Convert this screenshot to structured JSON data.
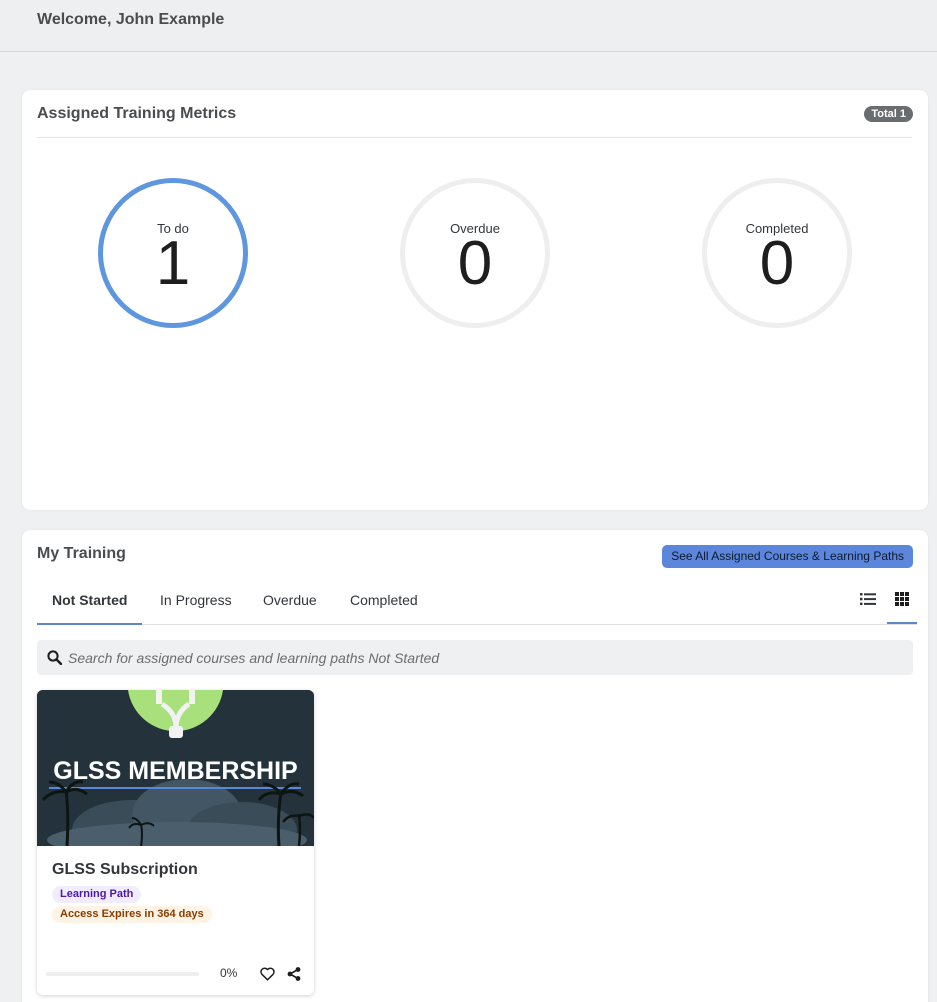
{
  "header": {
    "welcome": "Welcome, John Example"
  },
  "metrics": {
    "title": "Assigned Training Metrics",
    "total_badge": "Total 1",
    "items": [
      {
        "label": "To do",
        "value": "1",
        "ring_color": "#5f96e0"
      },
      {
        "label": "Overdue",
        "value": "0",
        "ring_color": "#eeeeee"
      },
      {
        "label": "Completed",
        "value": "0",
        "ring_color": "#eeeeee"
      }
    ]
  },
  "training": {
    "title": "My Training",
    "see_all_label": "See All Assigned Courses & Learning Paths",
    "tabs": [
      {
        "label": "Not Started",
        "selected": true
      },
      {
        "label": "In Progress",
        "selected": false
      },
      {
        "label": "Overdue",
        "selected": false
      },
      {
        "label": "Completed",
        "selected": false
      }
    ],
    "view_modes": [
      {
        "icon": "list-view-icon",
        "selected": false
      },
      {
        "icon": "grid-view-icon",
        "selected": true
      }
    ],
    "search": {
      "placeholder": "Search for assigned courses and learning paths Not Started",
      "value": ""
    },
    "courses": [
      {
        "image_text": "GLSS MEMBERSHIP",
        "name": "GLSS Subscription",
        "type_tag": "Learning Path",
        "expiry_tag": "Access Expires in 364 days",
        "progress_percent": 0,
        "progress_label": "0%",
        "icons": [
          "heart-icon",
          "share-icon"
        ]
      }
    ]
  },
  "colors": {
    "accent": "#5f96e0",
    "button": "#5b86db",
    "tab_underline": "#5f86c9",
    "learning_path_tag": "#4c1aa5",
    "expiry_tag": "#8a3d00"
  }
}
